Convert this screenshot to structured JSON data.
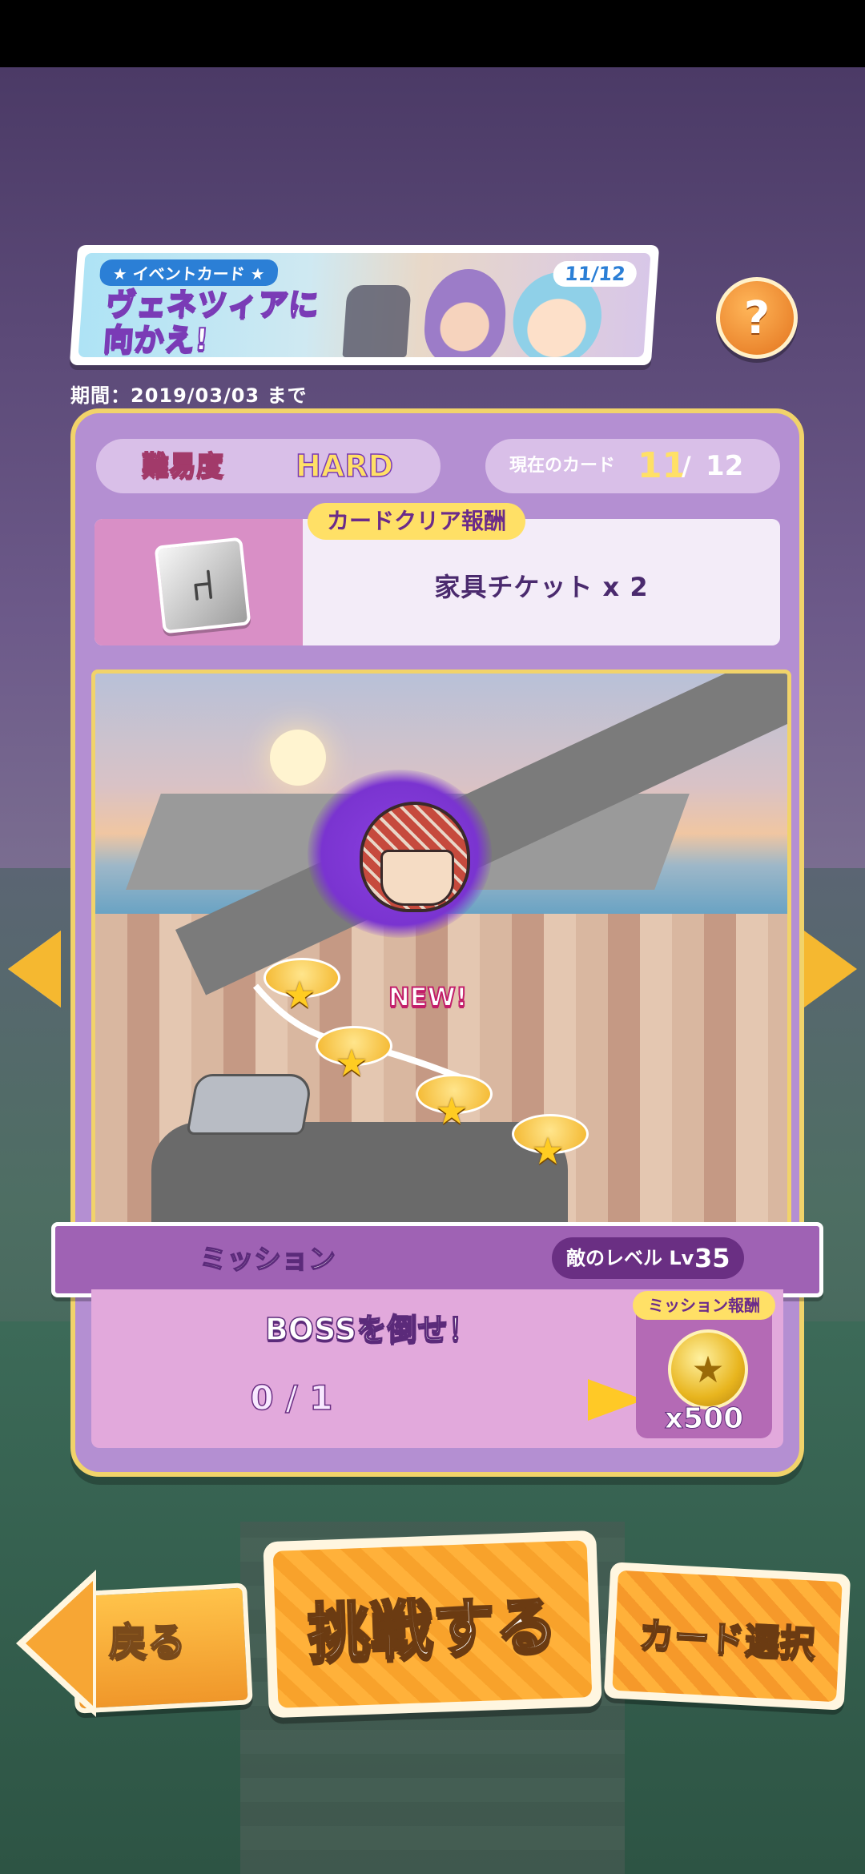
{
  "event_banner": {
    "tag": "★ イベントカード ★",
    "title": "ヴェネツィアに向かえ!",
    "progress": "11/12"
  },
  "help_icon": "?",
  "period": "期間：2019/03/03 まで",
  "difficulty": {
    "label": "難易度",
    "value": "HARD"
  },
  "current_card": {
    "label": "現在のカード",
    "current": "11",
    "separator": "/",
    "total": "12"
  },
  "card_reward": {
    "tag": "カードクリア報酬",
    "item": "家具チケット x 2",
    "icon": "chair-ticket-icon"
  },
  "map": {
    "new_badge": "NEW!",
    "stages_cleared": 4
  },
  "mission": {
    "title": "ミッション",
    "enemy_level_label": "敵のレベル Lv",
    "enemy_level": "35",
    "objective": "BOSSを倒せ！",
    "progress": "0 / 1",
    "reward_tag": "ミッション報酬",
    "reward_amount": "x500",
    "reward_icon": "coin-icon"
  },
  "buttons": {
    "back": "戻る",
    "challenge": "挑戦する",
    "card_select": "カード選択"
  },
  "colors": {
    "panel": "#b48fd2",
    "panel_border": "#f1d36a",
    "accent_yellow": "#ffe066",
    "button_orange": "#f8a22b"
  }
}
